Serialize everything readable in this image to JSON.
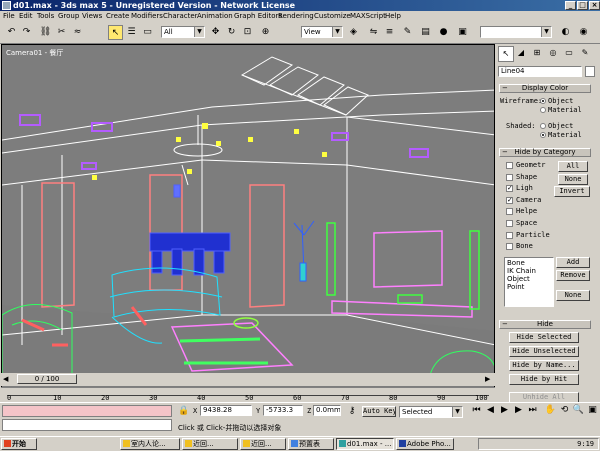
{
  "window": {
    "title": "d01.max - 3ds max 5 - Unregistered Version - Network License"
  },
  "menu": [
    "File",
    "Edit",
    "Tools",
    "Group",
    "Views",
    "Create",
    "Modifiers",
    "Character",
    "Animation",
    "Graph Editors",
    "Rendering",
    "Customize",
    "MAXScript",
    "Help"
  ],
  "toolbar": {
    "selection_filter": "All",
    "reference_coord": "View"
  },
  "viewport": {
    "label": "Camera01 - 餐厅"
  },
  "panel": {
    "object_name": "Line04",
    "display_color": {
      "header": "Display Color",
      "wireframe_label": "Wireframe:",
      "shaded_label": "Shaded:",
      "object": "Object",
      "material": "Material",
      "wireframe_selected": "Object",
      "shaded_selected": "Material"
    },
    "hide_by_category": {
      "header": "Hide by Category",
      "items": [
        {
          "label": "Geometr",
          "checked": false
        },
        {
          "label": "Shape",
          "checked": false
        },
        {
          "label": "Ligh",
          "checked": true
        },
        {
          "label": "Camera",
          "checked": true
        },
        {
          "label": "Helpe",
          "checked": false
        },
        {
          "label": "Space",
          "checked": false
        },
        {
          "label": "Particle",
          "checked": false
        },
        {
          "label": "Bone",
          "checked": false
        }
      ],
      "all_button": "All",
      "none_button": "None",
      "invert_button": "Invert",
      "list": [
        "Bone",
        "IK Chain Object",
        "Point"
      ],
      "add_button": "Add",
      "remove_button": "Remove",
      "none2_button": "None"
    },
    "hide": {
      "header": "Hide",
      "hide_selected": "Hide Selected",
      "hide_unselected": "Hide Unselected",
      "hide_by_name": "Hide by Name...",
      "hide_by_hit": "Hide by Hit",
      "unhide_all": "Unhide All"
    }
  },
  "timeline": {
    "frame": "0 / 100"
  },
  "trackbar": {
    "ticks": [
      "0",
      "10",
      "20",
      "30",
      "40",
      "50",
      "60",
      "70",
      "80",
      "90",
      "100"
    ]
  },
  "statusbar": {
    "x_label": "X",
    "x_value": "9438.28",
    "y_label": "Y",
    "y_value": "-5733.3",
    "z_label": "Z",
    "z_value": "0.0mm",
    "auto_key": "Auto Key",
    "selected_combo": "Selected",
    "prompt": "Click 或 Click-并拖动以选择对象"
  },
  "taskbar": {
    "start": "开始",
    "tasks": [
      "室内人论...",
      "近回...",
      "近回...",
      "预置表",
      "d01.max - ...",
      "Adobe Pho..."
    ],
    "time": "9:19"
  },
  "colors": {
    "title_start": "#0a246a",
    "title_end": "#3a6ea5",
    "viewport_bg": "#7d7d7d",
    "selected_tool": "#ffe870"
  }
}
